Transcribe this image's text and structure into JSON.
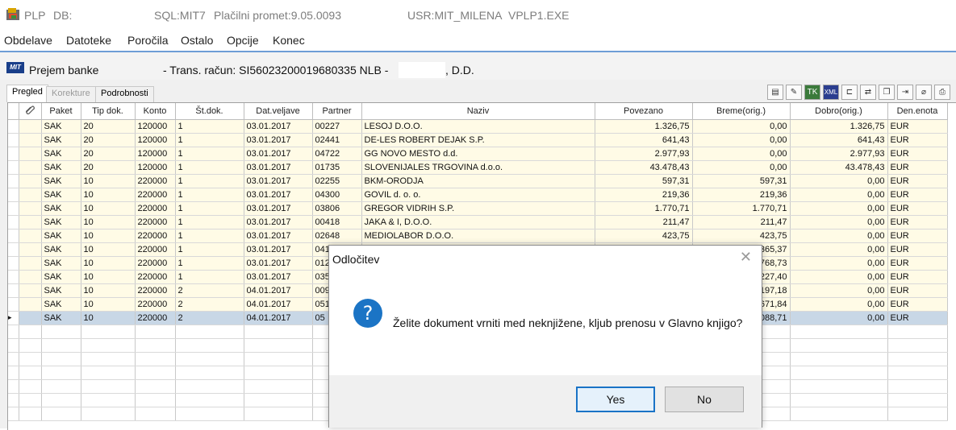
{
  "titlebar": {
    "app": "PLP",
    "db": "DB:",
    "sql": "SQL:MIT7",
    "module": "Plačilni promet:9.05.0093",
    "user": "USR:MIT_MILENA",
    "exe": "VPLP1.EXE"
  },
  "menu": [
    "Obdelave",
    "Datoteke",
    "Poročila",
    "Ostalo",
    "Opcije",
    "Konec"
  ],
  "subwindow": {
    "logo": "MIT",
    "title": "Prejem banke",
    "account": "- Trans. račun: SI56023200019680335  NLB -",
    "suffix": ", D.D."
  },
  "tabs": [
    "Pregled",
    "Korekture",
    "Podrobnosti"
  ],
  "toolbar_icons": [
    "report-icon",
    "edit-pen-icon",
    "tk-icon",
    "xml-icon",
    "tree-icon",
    "transfer-icon",
    "copy-doc-icon",
    "export-icon",
    "attach-icon",
    "print-icon"
  ],
  "grid": {
    "columns": [
      "",
      "Paket",
      "Tip dok.",
      "Konto",
      "Št.dok.",
      "Dat.veljave",
      "Partner",
      "Naziv",
      "Povezano",
      "Breme(orig.)",
      "Dobro(orig.)",
      "Den.enota"
    ],
    "rows": [
      [
        "SAK",
        "20",
        "120000",
        "1",
        "03.01.2017",
        "00227",
        "LESOJ D.O.O.",
        "1.326,75",
        "0,00",
        "1.326,75",
        "EUR"
      ],
      [
        "SAK",
        "20",
        "120000",
        "1",
        "03.01.2017",
        "02441",
        "DE-LES ROBERT DEJAK S.P.",
        "641,43",
        "0,00",
        "641,43",
        "EUR"
      ],
      [
        "SAK",
        "20",
        "120000",
        "1",
        "03.01.2017",
        "04722",
        "GG NOVO MESTO d.d.",
        "2.977,93",
        "0,00",
        "2.977,93",
        "EUR"
      ],
      [
        "SAK",
        "20",
        "120000",
        "1",
        "03.01.2017",
        "01735",
        "SLOVENIJALES TRGOVINA d.o.o.",
        "43.478,43",
        "0,00",
        "43.478,43",
        "EUR"
      ],
      [
        "SAK",
        "10",
        "220000",
        "1",
        "03.01.2017",
        "02255",
        "BKM-ORODJA",
        "597,31",
        "597,31",
        "0,00",
        "EUR"
      ],
      [
        "SAK",
        "10",
        "220000",
        "1",
        "03.01.2017",
        "04300",
        "GOVIL d. o. o.",
        "219,36",
        "219,36",
        "0,00",
        "EUR"
      ],
      [
        "SAK",
        "10",
        "220000",
        "1",
        "03.01.2017",
        "03806",
        "GREGOR VIDRIH S.P.",
        "1.770,71",
        "1.770,71",
        "0,00",
        "EUR"
      ],
      [
        "SAK",
        "10",
        "220000",
        "1",
        "03.01.2017",
        "00418",
        "JAKA & I, D.O.O.",
        "211,47",
        "211,47",
        "0,00",
        "EUR"
      ],
      [
        "SAK",
        "10",
        "220000",
        "1",
        "03.01.2017",
        "02648",
        "MEDIOLABOR D.O.O.",
        "423,75",
        "423,75",
        "0,00",
        "EUR"
      ],
      [
        "SAK",
        "10",
        "220000",
        "1",
        "03.01.2017",
        "041",
        "",
        "",
        "365,37",
        "0,00",
        "EUR"
      ],
      [
        "SAK",
        "10",
        "220000",
        "1",
        "03.01.2017",
        "012",
        "",
        "",
        "768,73",
        "0,00",
        "EUR"
      ],
      [
        "SAK",
        "10",
        "220000",
        "1",
        "03.01.2017",
        "035",
        "",
        "",
        "227,40",
        "0,00",
        "EUR"
      ],
      [
        "SAK",
        "10",
        "220000",
        "2",
        "04.01.2017",
        "009",
        "",
        "",
        "197,18",
        "0,00",
        "EUR"
      ],
      [
        "SAK",
        "10",
        "220000",
        "2",
        "04.01.2017",
        "051",
        "",
        "",
        "671,84",
        "0,00",
        "EUR"
      ],
      [
        "SAK",
        "10",
        "220000",
        "2",
        "04.01.2017",
        "05",
        "",
        "",
        "088,71",
        "0,00",
        "EUR"
      ]
    ],
    "current_row_marker": "▸"
  },
  "dialog": {
    "title": "Odločitev",
    "close": "✕",
    "icon": "?",
    "message": "Želite dokument vrniti med neknjižene, kljub prenosu v Glavno knjigo?",
    "yes": "Yes",
    "no": "No"
  }
}
